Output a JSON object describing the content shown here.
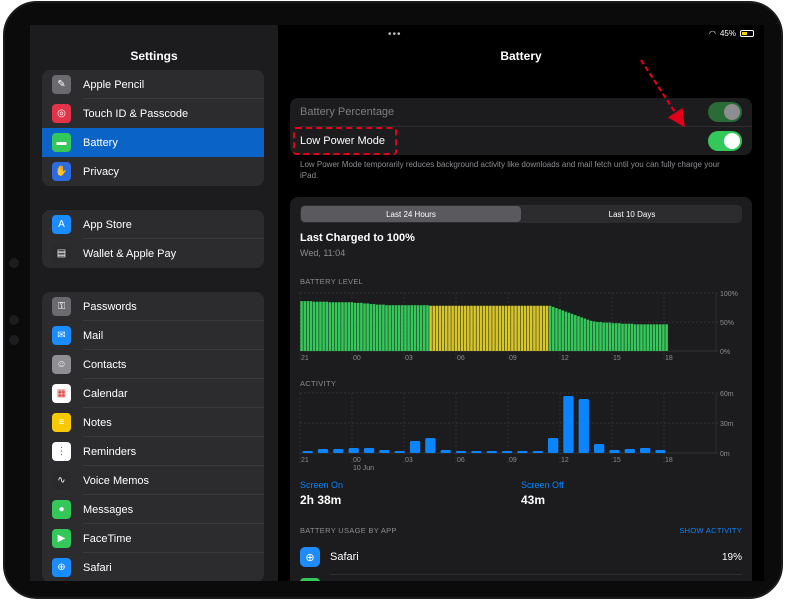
{
  "sidebar": {
    "title": "Settings",
    "group1": [
      {
        "label": "Apple Pencil",
        "icon": "pencil-icon",
        "color": "#6b6b6f",
        "glyph": "✎"
      },
      {
        "label": "Touch ID & Passcode",
        "icon": "fingerprint-icon",
        "color": "#e3334a",
        "glyph": "◎"
      },
      {
        "label": "Battery",
        "icon": "battery-icon",
        "color": "#34c759",
        "glyph": "▬",
        "active": true
      },
      {
        "label": "Privacy",
        "icon": "hand-icon",
        "color": "#2c6be0",
        "glyph": "✋"
      }
    ],
    "group2": [
      {
        "label": "App Store",
        "icon": "app-store-icon",
        "color": "#1a8cff",
        "glyph": "A"
      },
      {
        "label": "Wallet & Apple Pay",
        "icon": "wallet-icon",
        "color": "#2a2a2c",
        "glyph": "▤"
      }
    ],
    "group3": [
      {
        "label": "Passwords",
        "icon": "key-icon",
        "color": "#6b6b6f",
        "glyph": "⚿"
      },
      {
        "label": "Mail",
        "icon": "mail-icon",
        "color": "#1a8cff",
        "glyph": "✉"
      },
      {
        "label": "Contacts",
        "icon": "contacts-icon",
        "color": "#8e8e93",
        "glyph": "☺"
      },
      {
        "label": "Calendar",
        "icon": "calendar-icon",
        "color": "#ffffff",
        "glyph": "▦"
      },
      {
        "label": "Notes",
        "icon": "notes-icon",
        "color": "#f7c900",
        "glyph": "≡"
      },
      {
        "label": "Reminders",
        "icon": "reminders-icon",
        "color": "#ffffff",
        "glyph": "⋮"
      },
      {
        "label": "Voice Memos",
        "icon": "voice-memos-icon",
        "color": "#2a2a2c",
        "glyph": "∿"
      },
      {
        "label": "Messages",
        "icon": "messages-icon",
        "color": "#34c759",
        "glyph": "●"
      },
      {
        "label": "FaceTime",
        "icon": "facetime-icon",
        "color": "#34c759",
        "glyph": "▶"
      },
      {
        "label": "Safari",
        "icon": "safari-icon",
        "color": "#1a8cff",
        "glyph": "⊕"
      }
    ]
  },
  "detail": {
    "title": "Battery",
    "top_dots": "•••",
    "battery_pct": "45%",
    "battery_percentage_label": "Battery Percentage",
    "low_power_label": "Low Power Mode",
    "footnote": "Low Power Mode temporarily reduces background activity like downloads and mail fetch until you can fully charge your iPad.",
    "tabs": [
      "Last 24 Hours",
      "Last 10 Days"
    ],
    "last_charged": "Last Charged to 100%",
    "last_charged_time": "Wed, 11:04",
    "battery_level_label": "BATTERY LEVEL",
    "activity_label": "ACTIVITY",
    "screen_on_label": "Screen On",
    "screen_on_value": "2h 38m",
    "screen_off_label": "Screen Off",
    "screen_off_value": "43m",
    "usage_label": "BATTERY USAGE BY APP",
    "show_activity": "SHOW ACTIVITY",
    "apps": [
      {
        "name": "Safari",
        "pct": "19%",
        "icon": "safari-icon"
      }
    ]
  },
  "chart_data": [
    {
      "type": "bar",
      "title": "BATTERY LEVEL",
      "x_ticks": [
        "21",
        "00",
        "03",
        "06",
        "09",
        "12",
        "15",
        "18"
      ],
      "y_ticks": [
        "100%",
        "50%",
        "0%"
      ],
      "ylim": [
        0,
        100
      ],
      "values": [
        86,
        86,
        86,
        86,
        85,
        85,
        85,
        85,
        85,
        84,
        84,
        84,
        84,
        84,
        84,
        84,
        84,
        83,
        83,
        83,
        82,
        82,
        81,
        81,
        80,
        80,
        80,
        79,
        79,
        79,
        79,
        79,
        79,
        79,
        79,
        79,
        79,
        79,
        79,
        79,
        79,
        78,
        78,
        78,
        78,
        78,
        78,
        78,
        78,
        78,
        78,
        78,
        78,
        78,
        78,
        78,
        78,
        78,
        78,
        78,
        78,
        78,
        78,
        78,
        78,
        78,
        78,
        78,
        78,
        78,
        78,
        78,
        78,
        78,
        78,
        78,
        78,
        78,
        78,
        78,
        76,
        74,
        72,
        70,
        68,
        66,
        64,
        62,
        60,
        58,
        56,
        54,
        52,
        51,
        50,
        50,
        49,
        49,
        49,
        48,
        48,
        48,
        47,
        47,
        47,
        47,
        46,
        46,
        46,
        46,
        46,
        46,
        46,
        46,
        46,
        46,
        46
      ],
      "colors_by_index": {
        "green": [
          0,
          40
        ],
        "yellow": [
          41,
          78
        ],
        "green_after": [
          79,
          116
        ]
      },
      "colors": {
        "green": "#34c759",
        "yellow": "#d7c62a"
      }
    },
    {
      "type": "bar",
      "title": "ACTIVITY",
      "x_ticks": [
        "21",
        "00",
        "03",
        "06",
        "09",
        "12",
        "15",
        "18"
      ],
      "x_sublabel": "10 Jun",
      "y_ticks": [
        "60m",
        "30m",
        "0m"
      ],
      "ylim": [
        0,
        60
      ],
      "values": [
        2,
        4,
        4,
        5,
        5,
        3,
        0,
        12,
        15,
        3,
        2,
        2,
        2,
        2,
        2,
        0,
        15,
        57,
        54,
        9,
        3,
        4,
        5,
        3
      ],
      "color": "#0a84ff"
    }
  ]
}
